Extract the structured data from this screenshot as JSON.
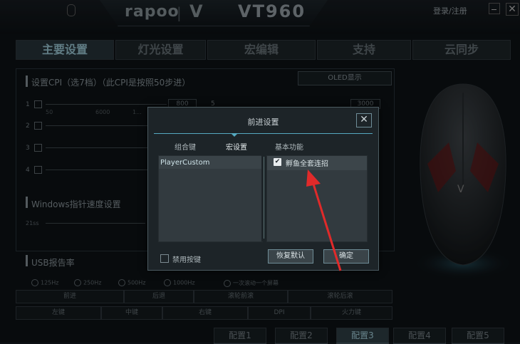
{
  "header": {
    "brand_left": "rapoo",
    "brand_sep": "|",
    "brand_v": "V",
    "model": "VT960",
    "login": "登录/注册",
    "close_icon": "✕"
  },
  "nav": {
    "tabs": [
      {
        "label": "主要设置",
        "active": true
      },
      {
        "label": "灯光设置",
        "active": false
      },
      {
        "label": "宏编辑",
        "active": false
      },
      {
        "label": "支持",
        "active": false
      },
      {
        "label": "云同步",
        "active": false
      }
    ]
  },
  "left": {
    "cpi_title": "设置CPI（选7档）（此CPI是按照50步进）",
    "oled_label": "OLED显示",
    "rows": [
      {
        "num": "1",
        "value": "800"
      },
      {
        "num": "2",
        "value": ""
      },
      {
        "num": "3",
        "value": ""
      },
      {
        "num": "4",
        "value": ""
      }
    ],
    "row5_num": "5",
    "row5_value": "3000",
    "ticks": [
      "50",
      "6000",
      "1..."
    ],
    "pointer_title": "Windows指针速度设置",
    "pointer_left": "21ss",
    "usb_title": "USB报告率",
    "rates": [
      "125Hz",
      "250Hz",
      "500Hz",
      "1000Hz"
    ],
    "scroll_option": "一次滚动一个屏幕",
    "buttons_row1": [
      "前进",
      "后退",
      "滚轮前滚",
      "滚轮后滚"
    ],
    "buttons_row2": [
      "左键",
      "中键",
      "右键",
      "DPI",
      "火力键"
    ]
  },
  "profiles": [
    "配置1",
    "配置2",
    "配置3",
    "配置4",
    "配置5"
  ],
  "active_profile": "配置3",
  "dialog": {
    "title": "前进设置",
    "close_icon": "✕",
    "tabs": [
      "组合键",
      "宏设置",
      "基本功能"
    ],
    "active_tab": "宏设置",
    "list_item": "PlayerCustom",
    "macro_checked_icon": "✔",
    "macro_name": "孵鱼全套连招",
    "disable_label": "禁用按键",
    "restore_button": "恢复默认",
    "ok_button": "确定"
  },
  "colors": {
    "accent": "#55a9c0",
    "arrow": "#e02a2a"
  }
}
